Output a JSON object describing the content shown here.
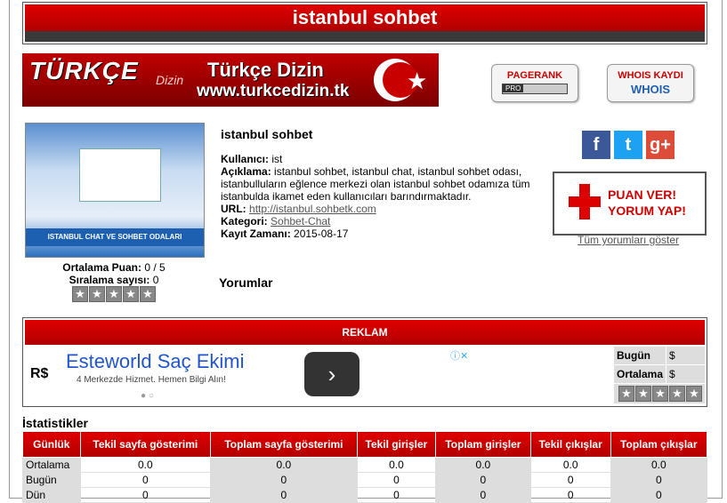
{
  "header": {
    "title": "istanbul sohbet"
  },
  "banner": {
    "logo_text": "TÜRKÇE",
    "logo_sub": "Dizin",
    "title": "Türkçe Dizin",
    "url": "www.turkcedizin.tk"
  },
  "badges": {
    "pagerank_top": "PAGERANK",
    "pagerank_bottom": "PRO",
    "whois_top": "WHOIS KAYDI",
    "whois_bottom": "WHOIS"
  },
  "site": {
    "name": "istanbul sohbet",
    "thumb_caption": "ISTANBUL CHAT VE SOHBET ODALARI",
    "user_label": "Kullanıcı:",
    "user": "ist",
    "desc_label": "Açıklama:",
    "desc": "istanbul sohbet, istanbul chat, istanbul sohbet odası, istanbulluların eğlence merkezi olan istanbul sohbet odamıza tüm istanbulda ikamet eden kullanıcıları barındırmaktadır.",
    "url_label": "URL:",
    "url": "http://istanbul.sohbetk.com",
    "cat_label": "Kategori:",
    "category": "Sohbet-Chat",
    "date_label": "Kayıt Zamanı:",
    "date": "2015-08-17"
  },
  "rating": {
    "avg_label": "Ortalama Puan:",
    "avg": "0 / 5",
    "count_label": "Sıralama sayısı:",
    "count": "0",
    "stars": 0
  },
  "comments": {
    "heading": "Yorumlar",
    "show_all": "Tüm yorumları göster"
  },
  "social": {
    "facebook": "f",
    "twitter": "t",
    "google": "g+"
  },
  "vote": {
    "line1": "PUAN VER!",
    "line2": "YORUM YAP!"
  },
  "reklam": {
    "heading": "REKLAM",
    "ad_logo": "R$",
    "ad_headline": "Esteworld Saç Ekimi",
    "ad_sub": "4 Merkezde Hizmet. Hemen Bilgi Alın!",
    "side": [
      {
        "label": "Bugün",
        "value": "$"
      },
      {
        "label": "Ortalama",
        "value": "$"
      }
    ]
  },
  "stats": {
    "title": "İstatistikler",
    "headers": [
      "Günlük",
      "Tekil sayfa gösterimi",
      "Toplam sayfa gösterimi",
      "Tekil girişler",
      "Toplam girişler",
      "Tekil çıkışlar",
      "Toplam çıkışlar"
    ],
    "rows": [
      [
        "Ortalama",
        "0.0",
        "0.0",
        "0.0",
        "0.0",
        "0.0",
        "0.0"
      ],
      [
        "Bugün",
        "0",
        "0",
        "0",
        "0",
        "0",
        "0"
      ],
      [
        "Dün",
        "0",
        "0",
        "0",
        "0",
        "0",
        "0"
      ]
    ]
  }
}
